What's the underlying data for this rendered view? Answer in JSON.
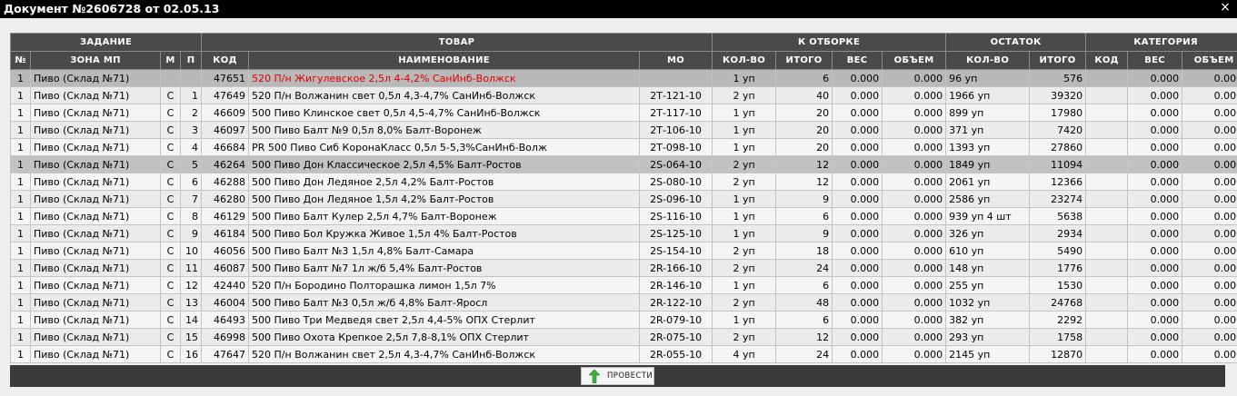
{
  "window": {
    "title": "Документ №2606728 от 02.05.13",
    "close_symbol": "×"
  },
  "groups": {
    "task": "ЗАДАНИЕ",
    "product": "ТОВАР",
    "to_pick": "К ОТБОРКЕ",
    "remainder": "ОСТАТОК",
    "category": "КАТЕГОРИЯ"
  },
  "columns": {
    "num": "№",
    "zone": "ЗОНА МП",
    "m": "М",
    "p": "П",
    "code": "КОД",
    "name": "НАИМЕНОВАНИЕ",
    "mo": "МО",
    "pick_qty": "КОЛ-ВО",
    "pick_total": "ИТОГО",
    "pick_weight": "ВЕС",
    "pick_volume": "ОБЪЕМ",
    "rem_qty": "КОЛ-ВО",
    "rem_total": "ИТОГО",
    "cat_code": "КОД",
    "cat_weight": "ВЕС",
    "cat_volume": "ОБЪЕМ"
  },
  "rows": [
    {
      "n": "1",
      "zone": "Пиво (Склад №71)",
      "m": "",
      "p": "",
      "code": "47651",
      "name": "520 П/н Жигулевское 2,5л 4-4,2% СанИнб-Волжск",
      "mo": "",
      "qty": "1 уп",
      "total": "6",
      "w": "0.000",
      "v": "0.000",
      "rq": "96 уп",
      "rt": "576",
      "cc": "",
      "cw": "0.000",
      "cv": "0.000",
      "style": "first",
      "red": true
    },
    {
      "n": "1",
      "zone": "Пиво (Склад №71)",
      "m": "С",
      "p": "1",
      "code": "47649",
      "name": "520 П/н Волжанин свет 0,5л 4,3-4,7% СанИнб-Волжск",
      "mo": "2Т-121-10",
      "qty": "2 уп",
      "total": "40",
      "w": "0.000",
      "v": "0.000",
      "rq": "1966 уп",
      "rt": "39320",
      "cc": "",
      "cw": "0.000",
      "cv": "0.000"
    },
    {
      "n": "1",
      "zone": "Пиво (Склад №71)",
      "m": "С",
      "p": "2",
      "code": "46609",
      "name": "500 Пиво Клинское свет 0,5л 4,5-4,7% СанИнб-Волжск",
      "mo": "2Т-117-10",
      "qty": "1 уп",
      "total": "20",
      "w": "0.000",
      "v": "0.000",
      "rq": "899 уп",
      "rt": "17980",
      "cc": "",
      "cw": "0.000",
      "cv": "0.000"
    },
    {
      "n": "1",
      "zone": "Пиво (Склад №71)",
      "m": "С",
      "p": "3",
      "code": "46097",
      "name": "500 Пиво Балт №9 0,5л 8,0% Балт-Воронеж",
      "mo": "2Т-106-10",
      "qty": "1 уп",
      "total": "20",
      "w": "0.000",
      "v": "0.000",
      "rq": "371 уп",
      "rt": "7420",
      "cc": "",
      "cw": "0.000",
      "cv": "0.000"
    },
    {
      "n": "1",
      "zone": "Пиво (Склад №71)",
      "m": "С",
      "p": "4",
      "code": "46684",
      "name": "PR 500 Пиво Сиб КоронаКласс 0,5л 5-5,3%СанИнб-Волж",
      "mo": "2Т-098-10",
      "qty": "1 уп",
      "total": "20",
      "w": "0.000",
      "v": "0.000",
      "rq": "1393 уп",
      "rt": "27860",
      "cc": "",
      "cw": "0.000",
      "cv": "0.000"
    },
    {
      "n": "1",
      "zone": "Пиво (Склад №71)",
      "m": "С",
      "p": "5",
      "code": "46264",
      "name": "500 Пиво Дон Классическое 2,5л 4,5% Балт-Ростов",
      "mo": "2S-064-10",
      "qty": "2 уп",
      "total": "12",
      "w": "0.000",
      "v": "0.000",
      "rq": "1849 уп",
      "rt": "11094",
      "cc": "",
      "cw": "0.000",
      "cv": "0.000",
      "style": "sel"
    },
    {
      "n": "1",
      "zone": "Пиво (Склад №71)",
      "m": "С",
      "p": "6",
      "code": "46288",
      "name": "500 Пиво Дон Ледяное 2,5л 4,2% Балт-Ростов",
      "mo": "2S-080-10",
      "qty": "2 уп",
      "total": "12",
      "w": "0.000",
      "v": "0.000",
      "rq": "2061 уп",
      "rt": "12366",
      "cc": "",
      "cw": "0.000",
      "cv": "0.000"
    },
    {
      "n": "1",
      "zone": "Пиво (Склад №71)",
      "m": "С",
      "p": "7",
      "code": "46280",
      "name": "500 Пиво Дон Ледяное 1,5л 4,2% Балт-Ростов",
      "mo": "2S-096-10",
      "qty": "1 уп",
      "total": "9",
      "w": "0.000",
      "v": "0.000",
      "rq": "2586 уп",
      "rt": "23274",
      "cc": "",
      "cw": "0.000",
      "cv": "0.000"
    },
    {
      "n": "1",
      "zone": "Пиво (Склад №71)",
      "m": "С",
      "p": "8",
      "code": "46129",
      "name": "500 Пиво Балт Кулер 2,5л 4,7% Балт-Воронеж",
      "mo": "2S-116-10",
      "qty": "1 уп",
      "total": "6",
      "w": "0.000",
      "v": "0.000",
      "rq": "939 уп 4 шт",
      "rt": "5638",
      "cc": "",
      "cw": "0.000",
      "cv": "0.000"
    },
    {
      "n": "1",
      "zone": "Пиво (Склад №71)",
      "m": "С",
      "p": "9",
      "code": "46184",
      "name": "500 Пиво Бол Кружка Живое 1,5л 4% Балт-Ростов",
      "mo": "2S-125-10",
      "qty": "1 уп",
      "total": "9",
      "w": "0.000",
      "v": "0.000",
      "rq": "326 уп",
      "rt": "2934",
      "cc": "",
      "cw": "0.000",
      "cv": "0.000"
    },
    {
      "n": "1",
      "zone": "Пиво (Склад №71)",
      "m": "С",
      "p": "10",
      "code": "46056",
      "name": "500 Пиво Балт №3 1,5л 4,8% Балт-Самара",
      "mo": "2S-154-10",
      "qty": "2 уп",
      "total": "18",
      "w": "0.000",
      "v": "0.000",
      "rq": "610 уп",
      "rt": "5490",
      "cc": "",
      "cw": "0.000",
      "cv": "0.000"
    },
    {
      "n": "1",
      "zone": "Пиво (Склад №71)",
      "m": "С",
      "p": "11",
      "code": "46087",
      "name": "500 Пиво Балт №7 1л ж/б 5,4% Балт-Ростов",
      "mo": "2R-166-10",
      "qty": "2 уп",
      "total": "24",
      "w": "0.000",
      "v": "0.000",
      "rq": "148 уп",
      "rt": "1776",
      "cc": "",
      "cw": "0.000",
      "cv": "0.000"
    },
    {
      "n": "1",
      "zone": "Пиво (Склад №71)",
      "m": "С",
      "p": "12",
      "code": "42440",
      "name": "520 П/н Бородино Полторашка лимон 1,5л 7%",
      "mo": "2R-146-10",
      "qty": "1 уп",
      "total": "6",
      "w": "0.000",
      "v": "0.000",
      "rq": "255 уп",
      "rt": "1530",
      "cc": "",
      "cw": "0.000",
      "cv": "0.000"
    },
    {
      "n": "1",
      "zone": "Пиво (Склад №71)",
      "m": "С",
      "p": "13",
      "code": "46004",
      "name": "500 Пиво Балт №3 0,5л ж/б 4,8% Балт-Яросл",
      "mo": "2R-122-10",
      "qty": "2 уп",
      "total": "48",
      "w": "0.000",
      "v": "0.000",
      "rq": "1032 уп",
      "rt": "24768",
      "cc": "",
      "cw": "0.000",
      "cv": "0.000"
    },
    {
      "n": "1",
      "zone": "Пиво (Склад №71)",
      "m": "С",
      "p": "14",
      "code": "46493",
      "name": "500 Пиво Три Медведя свет 2,5л 4,4-5% ОПХ Стерлит",
      "mo": "2R-079-10",
      "qty": "1 уп",
      "total": "6",
      "w": "0.000",
      "v": "0.000",
      "rq": "382 уп",
      "rt": "2292",
      "cc": "",
      "cw": "0.000",
      "cv": "0.000"
    },
    {
      "n": "1",
      "zone": "Пиво (Склад №71)",
      "m": "С",
      "p": "15",
      "code": "46998",
      "name": "500 Пиво Охота Крепкое 2,5л 7,8-8,1% ОПХ Стерлит",
      "mo": "2R-075-10",
      "qty": "2 уп",
      "total": "12",
      "w": "0.000",
      "v": "0.000",
      "rq": "293 уп",
      "rt": "1758",
      "cc": "",
      "cw": "0.000",
      "cv": "0.000"
    },
    {
      "n": "1",
      "zone": "Пиво (Склад №71)",
      "m": "С",
      "p": "16",
      "code": "47647",
      "name": "520 П/н Волжанин свет 2,5л 4,3-4,7% СанИнб-Волжск",
      "mo": "2R-055-10",
      "qty": "4 уп",
      "total": "24",
      "w": "0.000",
      "v": "0.000",
      "rq": "2145 уп",
      "rt": "12870",
      "cc": "",
      "cw": "0.000",
      "cv": "0.000"
    }
  ],
  "footer": {
    "submit_label": "ПРОВЕСТИ"
  },
  "colors": {
    "header_bg": "#4a4a4a",
    "highlight_text": "#e00000",
    "button_arrow": "#3bb33b"
  },
  "icons": {
    "close": "close-icon",
    "submit": "arrow-up-icon"
  }
}
